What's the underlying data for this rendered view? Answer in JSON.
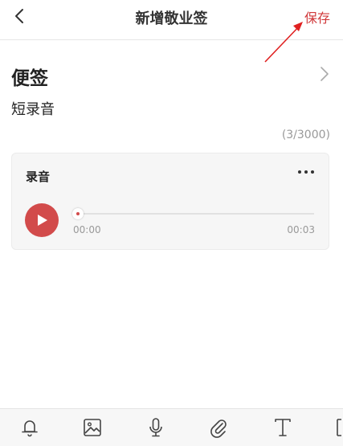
{
  "header": {
    "title": "新增敬业签",
    "save_label": "保存"
  },
  "note": {
    "category": "便签",
    "text": "短录音",
    "counter": "(3/3000)"
  },
  "audio": {
    "title": "录音",
    "current_time": "00:00",
    "duration": "00:03",
    "progress": 0
  },
  "toolbar": {
    "icons": [
      "bell-icon",
      "image-icon",
      "microphone-icon",
      "paperclip-icon",
      "text-icon",
      "more-tools-icon"
    ]
  },
  "colors": {
    "accent": "#d0383a",
    "play_button": "#d24b4b",
    "annotation_arrow": "#e02020"
  }
}
